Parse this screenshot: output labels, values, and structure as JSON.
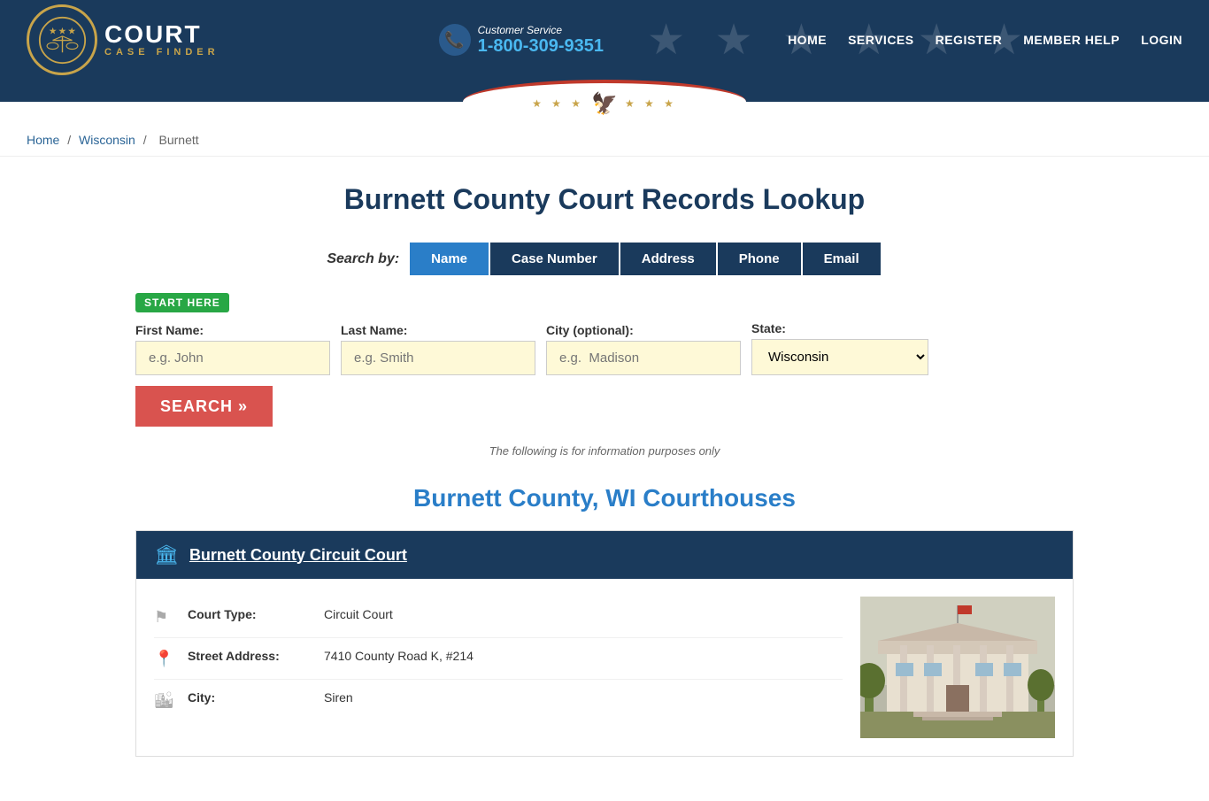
{
  "header": {
    "logo_title": "COURT",
    "logo_subtitle": "CASE FINDER",
    "customer_service_label": "Customer Service",
    "customer_service_number": "1-800-309-9351",
    "nav": [
      {
        "label": "HOME",
        "id": "nav-home"
      },
      {
        "label": "SERVICES",
        "id": "nav-services"
      },
      {
        "label": "REGISTER",
        "id": "nav-register"
      },
      {
        "label": "MEMBER HELP",
        "id": "nav-member-help"
      },
      {
        "label": "LOGIN",
        "id": "nav-login"
      }
    ]
  },
  "breadcrumb": {
    "home": "Home",
    "state": "Wisconsin",
    "county": "Burnett"
  },
  "page": {
    "title": "Burnett County Court Records Lookup",
    "search_by_label": "Search by:",
    "search_tabs": [
      {
        "label": "Name",
        "active": true
      },
      {
        "label": "Case Number",
        "active": false
      },
      {
        "label": "Address",
        "active": false
      },
      {
        "label": "Phone",
        "active": false
      },
      {
        "label": "Email",
        "active": false
      }
    ],
    "start_here_badge": "START HERE",
    "form": {
      "first_name_label": "First Name:",
      "first_name_placeholder": "e.g. John",
      "last_name_label": "Last Name:",
      "last_name_placeholder": "e.g. Smith",
      "city_label": "City (optional):",
      "city_placeholder": "e.g.  Madison",
      "state_label": "State:",
      "state_value": "Wisconsin",
      "search_button": "SEARCH"
    },
    "info_note": "The following is for information purposes only",
    "courthouses_title": "Burnett County, WI Courthouses",
    "courts": [
      {
        "name": "Burnett County Circuit Court",
        "court_type_label": "Court Type:",
        "court_type_value": "Circuit Court",
        "address_label": "Street Address:",
        "address_value": "7410 County Road K, #214",
        "city_label": "City:",
        "city_value": "Siren"
      }
    ]
  }
}
